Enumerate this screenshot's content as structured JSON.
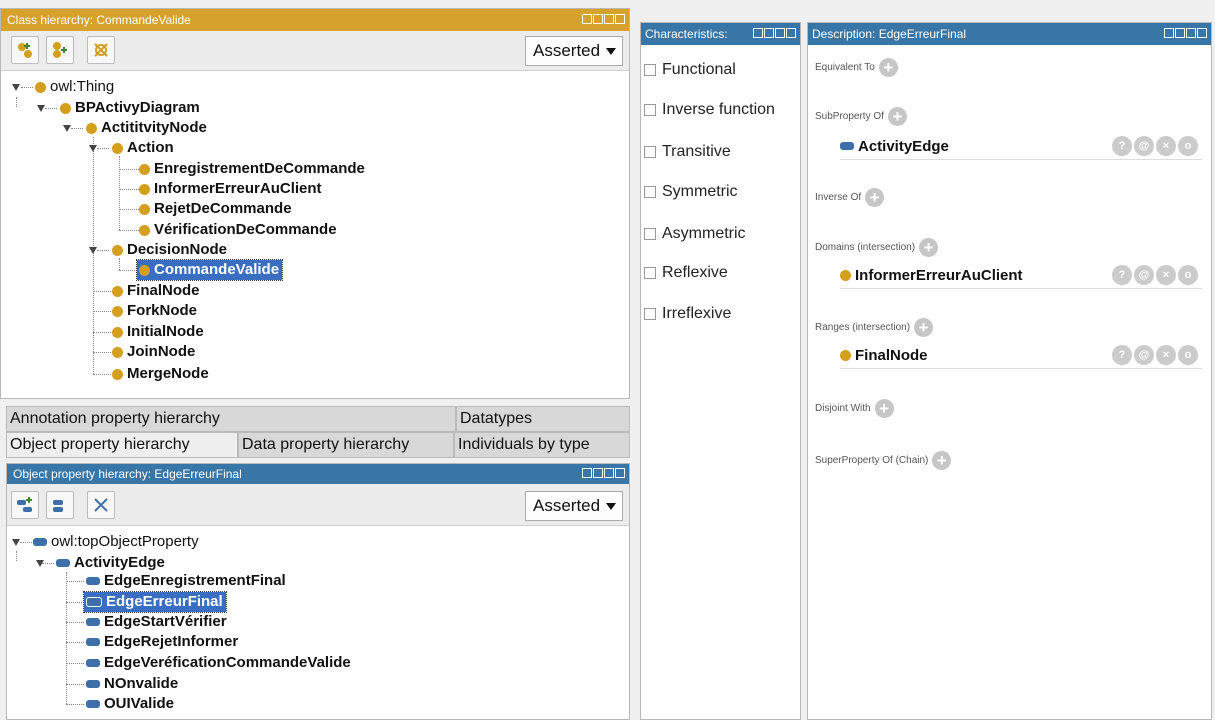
{
  "class_panel": {
    "title": "Class hierarchy: CommandeValide",
    "asserted": "Asserted",
    "tree": [
      {
        "label": "owl:Thing"
      },
      {
        "label": "BPActivyDiagram"
      },
      {
        "label": "ActititvityNode"
      },
      {
        "label": "Action"
      },
      {
        "label": "EnregistrementDeCommande"
      },
      {
        "label": "InformerErreurAuClient"
      },
      {
        "label": "RejetDeCommande"
      },
      {
        "label": "VérificationDeCommande"
      },
      {
        "label": "DecisionNode"
      },
      {
        "label": "CommandeValide"
      },
      {
        "label": "FinalNode"
      },
      {
        "label": "ForkNode"
      },
      {
        "label": "InitialNode"
      },
      {
        "label": "JoinNode"
      },
      {
        "label": "MergeNode"
      }
    ]
  },
  "tabs": {
    "annotation": "Annotation property hierarchy",
    "datatypes": "Datatypes",
    "object": "Object property hierarchy",
    "data": "Data property hierarchy",
    "individuals": "Individuals by type"
  },
  "object_panel": {
    "title": "Object property hierarchy: EdgeErreurFinal",
    "asserted": "Asserted",
    "tree": [
      {
        "label": "owl:topObjectProperty"
      },
      {
        "label": "ActivityEdge"
      },
      {
        "label": "EdgeEnregistrementFinal"
      },
      {
        "label": "EdgeErreurFinal"
      },
      {
        "label": "EdgeStartVérifier"
      },
      {
        "label": "EdgeRejetInformer"
      },
      {
        "label": "EdgeVeréficationCommandeValide"
      },
      {
        "label": "NOnvalide"
      },
      {
        "label": "OUIValide"
      }
    ]
  },
  "characteristics": {
    "title": "Characteristics:",
    "items": [
      "Functional",
      "Inverse function",
      "Transitive",
      "Symmetric",
      "Asymmetric",
      "Reflexive",
      "Irreflexive"
    ]
  },
  "description": {
    "title": "Description: EdgeErreurFinal",
    "equivalent": "Equivalent To",
    "subproperty": "SubProperty Of",
    "subproperty_value": "ActivityEdge",
    "inverse": "Inverse Of",
    "domains": "Domains (intersection)",
    "domains_value": "InformerErreurAuClient",
    "ranges": "Ranges (intersection)",
    "ranges_value": "FinalNode",
    "disjoint": "Disjoint With",
    "superprop": "SuperProperty Of (Chain)",
    "action_icons": [
      "?",
      "@",
      "×",
      "o"
    ]
  },
  "colors": {
    "class_title": "#d7a22c",
    "prop_title": "#3776a7",
    "class_dot": "#d39f1d",
    "prop_pill": "#3d6fa8",
    "selection": "#3a6ec2"
  }
}
